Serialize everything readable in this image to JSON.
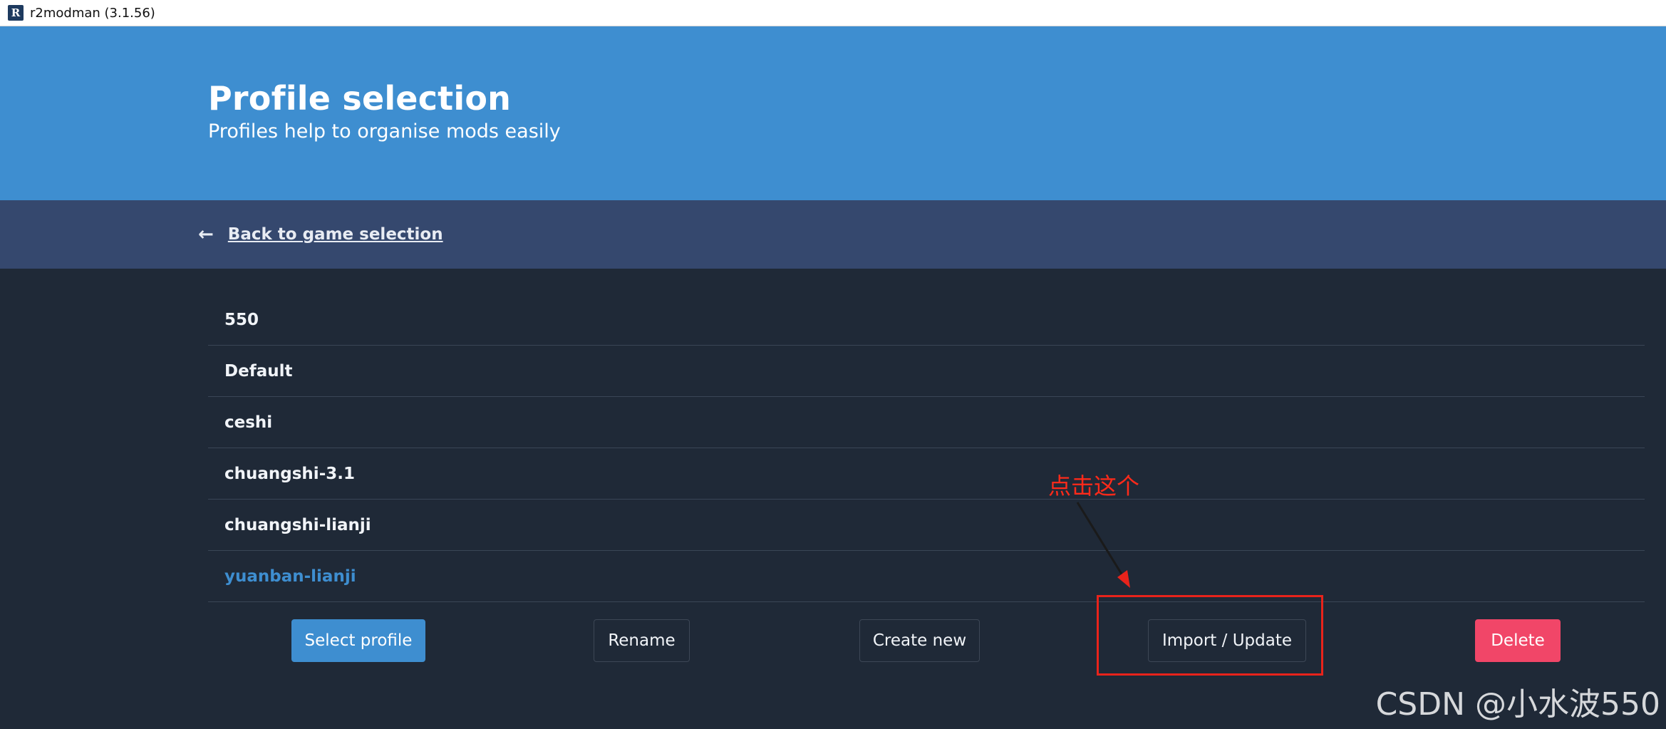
{
  "window": {
    "icon_letter": "R",
    "title": "r2modman (3.1.56)"
  },
  "header": {
    "title": "Profile selection",
    "subtitle": "Profiles help to organise mods easily"
  },
  "nav": {
    "back_arrow_icon": "arrow-left-icon",
    "back_label": "Back to game selection"
  },
  "profiles": [
    {
      "name": "550",
      "selected": false
    },
    {
      "name": "Default",
      "selected": false
    },
    {
      "name": "ceshi",
      "selected": false
    },
    {
      "name": "chuangshi-3.1",
      "selected": false
    },
    {
      "name": "chuangshi-lianji",
      "selected": false
    },
    {
      "name": "yuanban-lianji",
      "selected": true
    }
  ],
  "actions": {
    "select_profile": "Select profile",
    "rename": "Rename",
    "create_new": "Create new",
    "import_update": "Import / Update",
    "delete": "Delete"
  },
  "annotation": {
    "text": "点击这个",
    "color": "#e8231b"
  },
  "watermark": "CSDN @小水波550",
  "colors": {
    "primary": "#3e8ed0",
    "nav_bg": "#35486e",
    "body_bg": "#1f2937",
    "danger": "#f14668"
  }
}
